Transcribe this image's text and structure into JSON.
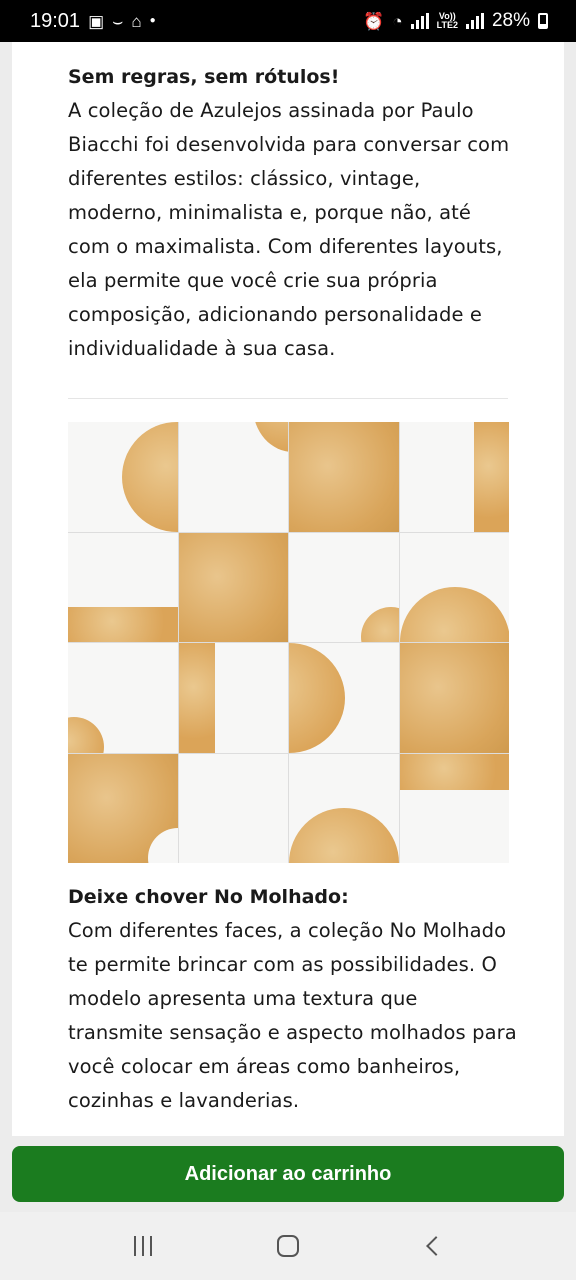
{
  "status_bar": {
    "time": "19:01",
    "battery": "28%",
    "volte_label": "Vo))\nLTE2",
    "left_icons": [
      "gallery-icon",
      "amazon-icon",
      "store-app-icon",
      "notification-dot-icon"
    ],
    "right_icons": [
      "alarm-clock-icon",
      "wifi-icon",
      "signal-icon",
      "volte-icon",
      "signal-icon",
      "battery-icon"
    ]
  },
  "section1": {
    "heading": "Sem regras, sem rótulos!",
    "body": "A coleção de Azulejos assinada por Paulo Biacchi foi desenvolvida para conversar com diferentes estilos: clássico, vintage, moderno, minimalista e, porque não, até com o maximalista. Com diferentes layouts, ela permite que você crie sua própria composição, adicionando personalidade e individualidade à sua casa."
  },
  "product_image": {
    "colors": {
      "ochre": "#dba458",
      "white": "#f7f7f6",
      "grout": "#dddddd"
    }
  },
  "section2": {
    "heading": "Deixe chover No Molhado:",
    "body": "Com diferentes faces, a coleção No Molhado te permite brincar com as possibilidades. O modelo apresenta uma textura que transmite sensação e aspecto molhados para você colocar em áreas como banheiros, cozinhas e lavanderias."
  },
  "cart": {
    "button_label": "Adicionar ao carrinho",
    "color": "#1b7c1f"
  },
  "navbar": {
    "icons": [
      "recents-icon",
      "home-icon",
      "back-icon"
    ]
  }
}
